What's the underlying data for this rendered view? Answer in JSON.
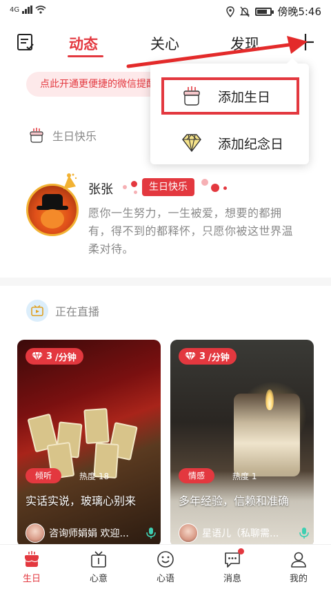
{
  "status_bar": {
    "network": "4G",
    "time": "傍晚5:46"
  },
  "nav": {
    "tabs": [
      {
        "label": "动态",
        "active": true
      },
      {
        "label": "关心",
        "active": false
      },
      {
        "label": "发现",
        "active": false
      }
    ],
    "left_icon": "calendar-list-icon",
    "right_icon": "plus-icon"
  },
  "banner": {
    "text": "点此开通更便捷的微信提醒"
  },
  "birthday_section": {
    "title": "生日快乐",
    "icon": "cake-icon",
    "friend_name": "张张",
    "badge": "生日快乐",
    "wish": "愿你一生努力，一生被爱，想要的都拥有，得不到的都释怀，只愿你被这世界温柔对待。"
  },
  "live_section": {
    "title": "正在直播",
    "icon": "live-tv-icon",
    "cards": [
      {
        "price": "3",
        "price_unit": "/分钟",
        "category": "倾听",
        "heat": "热度 18",
        "title": "实话实说，玻璃心别来",
        "host": "咨询师娟娟 欢迎..."
      },
      {
        "price": "3",
        "price_unit": "/分钟",
        "category": "情感",
        "heat": "热度 1",
        "title": "多年经验，信赖和准确",
        "host": "星语儿（私聊需..."
      }
    ]
  },
  "dropdown_menu": {
    "items": [
      {
        "label": "添加生日",
        "icon": "cake-icon",
        "highlighted": true
      },
      {
        "label": "添加纪念日",
        "icon": "diamond-icon",
        "highlighted": false
      }
    ]
  },
  "bottom_bar": {
    "items": [
      {
        "label": "生日",
        "icon": "cake-icon",
        "active": true
      },
      {
        "label": "心意",
        "icon": "gift-tv-icon",
        "active": false
      },
      {
        "label": "心语",
        "icon": "smile-icon",
        "active": false
      },
      {
        "label": "消息",
        "icon": "chat-icon",
        "active": false,
        "badge_dot": true
      },
      {
        "label": "我的",
        "icon": "person-icon",
        "active": false
      }
    ]
  },
  "colors": {
    "accent": "#e3383f",
    "banner_bg": "#fde9ea",
    "muted_text": "#888888"
  }
}
